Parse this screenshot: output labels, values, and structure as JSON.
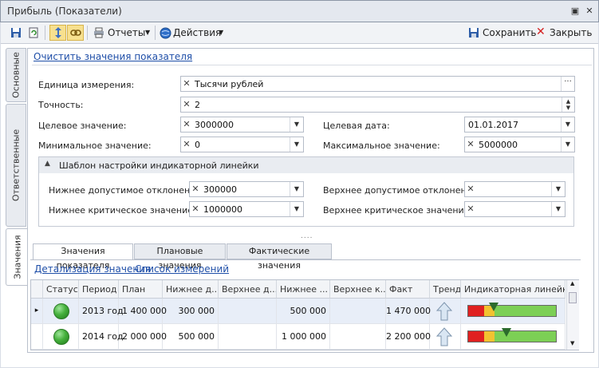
{
  "window": {
    "title": "Прибыль (Показатели)",
    "controls": [
      "▣",
      "✕"
    ]
  },
  "toolbar": {
    "reports_label": "Отчеты",
    "actions_label": "Действия",
    "save_label": "Сохранить",
    "close_label": "Закрыть"
  },
  "side_tabs": [
    "Основные",
    "Ответственные",
    "Значения"
  ],
  "clear_link": "Очистить значения показателя",
  "form": {
    "unit": {
      "label": "Единица измерения:",
      "value": "Тысячи рублей"
    },
    "precision": {
      "label": "Точность:",
      "value": "2"
    },
    "target_value": {
      "label": "Целевое значение:",
      "value": "3000000"
    },
    "target_date": {
      "label": "Целевая дата:",
      "value": "01.01.2017"
    },
    "min_value": {
      "label": "Минимальное значение:",
      "value": "0"
    },
    "max_value": {
      "label": "Максимальное значение:",
      "value": "5000000"
    }
  },
  "template_group": {
    "title": "Шаблон настройки индикаторной линейки",
    "lower_allowed": {
      "label": "Нижнее допустимое отклонение:",
      "value": "300000"
    },
    "lower_critical": {
      "label": "Нижнее критическое значение:",
      "value": "1000000"
    },
    "upper_allowed": {
      "label": "Верхнее допустимое отклонение:",
      "value": ""
    },
    "upper_critical": {
      "label": "Верхнее критическое значение:",
      "value": ""
    }
  },
  "splitter": "....",
  "tabs": [
    "Значения показателя",
    "Плановые значения",
    "Фактические значения"
  ],
  "links": {
    "detail": "Детализация значения",
    "measures": "Список измерений"
  },
  "grid": {
    "columns": [
      "Статус",
      "Период",
      "План",
      "Нижнее д...",
      "Верхнее д...",
      "Нижнее ...",
      "Верхнее к...",
      "Факт",
      "Тренд",
      "Индикаторная линейка"
    ],
    "rows": [
      {
        "status": "green",
        "period": "2013 год",
        "plan": "1 400 000",
        "lower_dev": "300 000",
        "upper_dev": "",
        "lower_crit": "500 000",
        "upper_crit": "",
        "fact": "1 470 000",
        "trend": "up",
        "indicator_pos": 0.29
      },
      {
        "status": "green",
        "period": "2014 год",
        "plan": "2 000 000",
        "lower_dev": "500 000",
        "upper_dev": "",
        "lower_crit": "1 000 000",
        "upper_crit": "",
        "fact": "2 200 000",
        "trend": "up",
        "indicator_pos": 0.44
      }
    ]
  },
  "colors": {
    "accent_link": "#1f4fa8",
    "status_green": "#46b13d",
    "indicator_red": "#e02020",
    "indicator_yellow": "#f2c230",
    "indicator_green": "#7ccf55"
  }
}
